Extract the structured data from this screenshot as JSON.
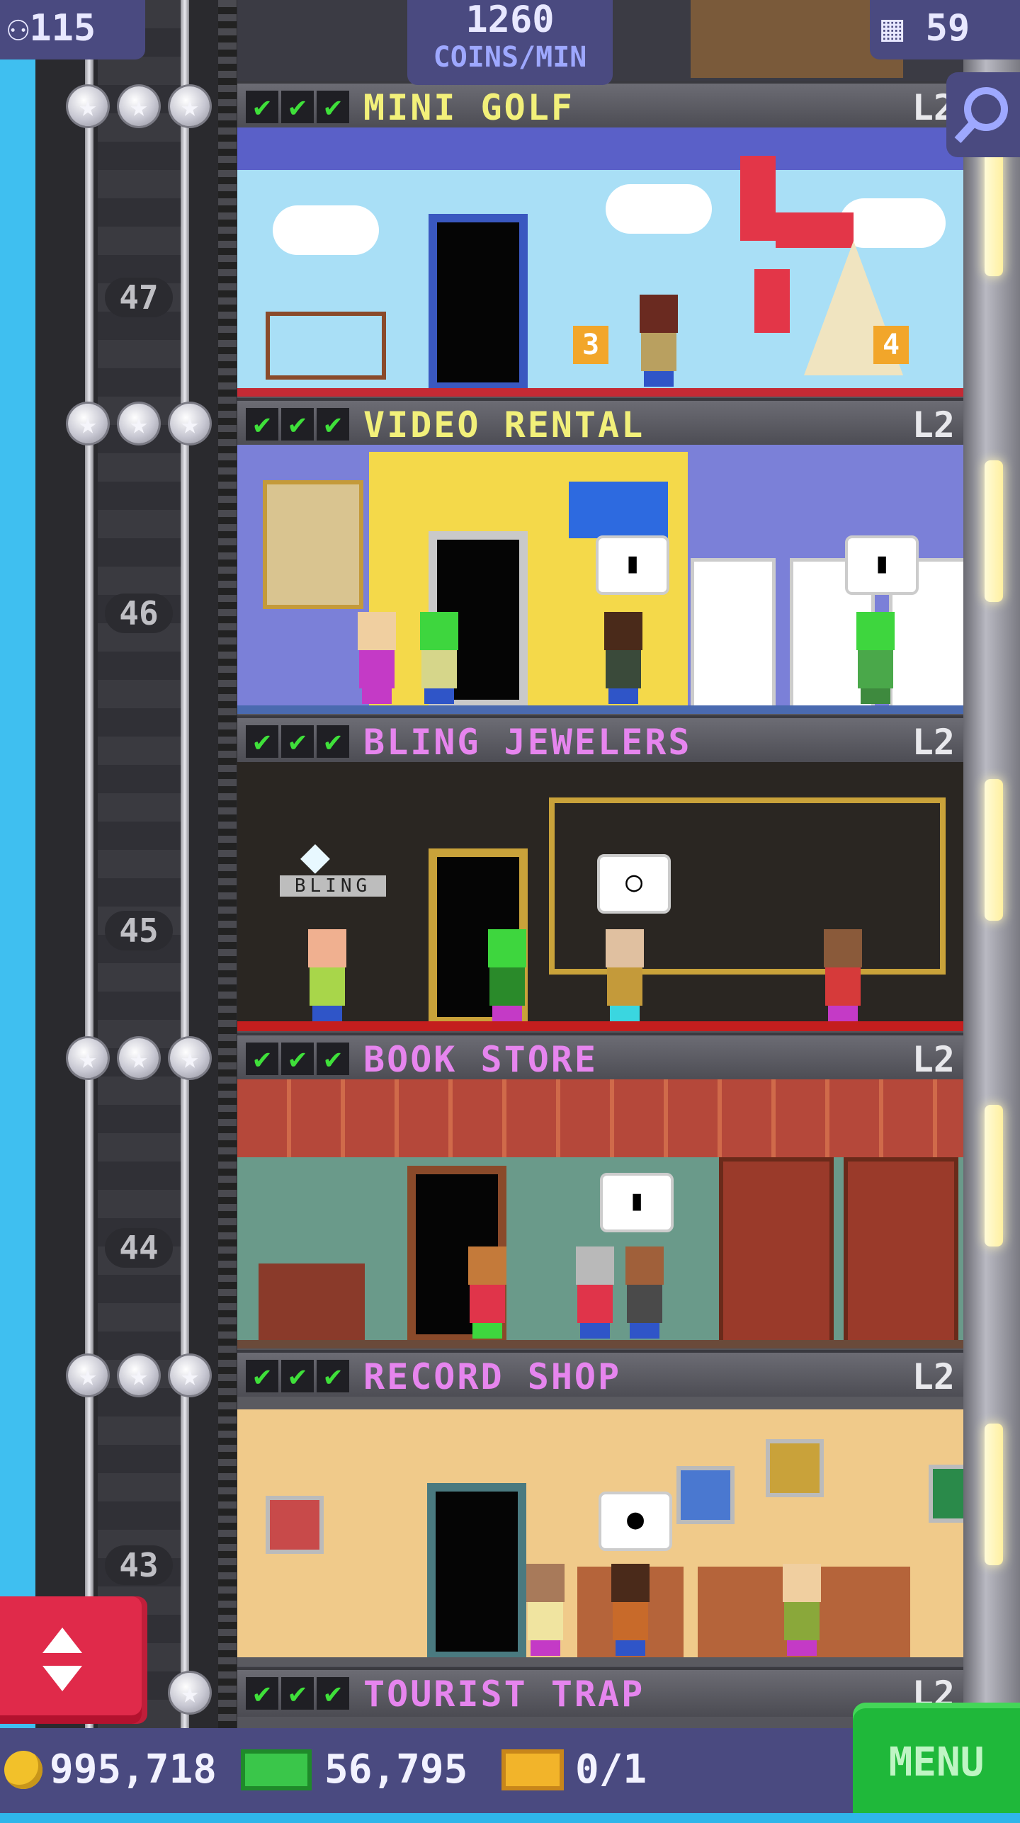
{
  "hud": {
    "population": "115",
    "coins_per_min_value": "1260",
    "coins_per_min_label": "COINS/MIN",
    "floors_count": "59",
    "coins": "995,718",
    "bux": "56,795",
    "vip_count": "0/1",
    "menu_label": "MENU"
  },
  "floor_numbers": [
    "47",
    "46",
    "45",
    "44",
    "43"
  ],
  "floors": [
    {
      "name": "MINI GOLF",
      "level": "L2",
      "name_color": "#f2f07a",
      "checks": [
        "✔",
        "✔",
        "✔"
      ]
    },
    {
      "name": "VIDEO RENTAL",
      "level": "L2",
      "name_color": "#f2f07a",
      "checks": [
        "✔",
        "✔",
        "✔"
      ]
    },
    {
      "name": "BLING JEWELERS",
      "level": "L2",
      "name_color": "#e685ee",
      "checks": [
        "✔",
        "✔",
        "✔"
      ]
    },
    {
      "name": "BOOK STORE",
      "level": "L2",
      "name_color": "#e685ee",
      "checks": [
        "✔",
        "✔",
        "✔"
      ]
    },
    {
      "name": "RECORD SHOP",
      "level": "L2",
      "name_color": "#e685ee",
      "checks": [
        "✔",
        "✔",
        "✔"
      ]
    },
    {
      "name": "TOURIST TRAP",
      "level": "L2",
      "name_color": "#e685ee",
      "checks": [
        "✔",
        "✔",
        "✔"
      ]
    }
  ],
  "room_signs": {
    "golf_hole_a": "3",
    "golf_hole_b": "4",
    "jewelers_sign": "BLING"
  },
  "icons": {
    "population": "person-icon",
    "floors": "building-icon",
    "zoom": "magnifier-icon",
    "elevator": "up-down-arrows-icon",
    "coin": "coin-icon",
    "bux": "bux-bill-icon",
    "vip": "vip-ticket-icon"
  },
  "colors": {
    "hud_bg": "#4a4a80",
    "menu_green": "#1fb83a",
    "elevator_red": "#e02a4a",
    "check_green": "#3fe03a"
  }
}
